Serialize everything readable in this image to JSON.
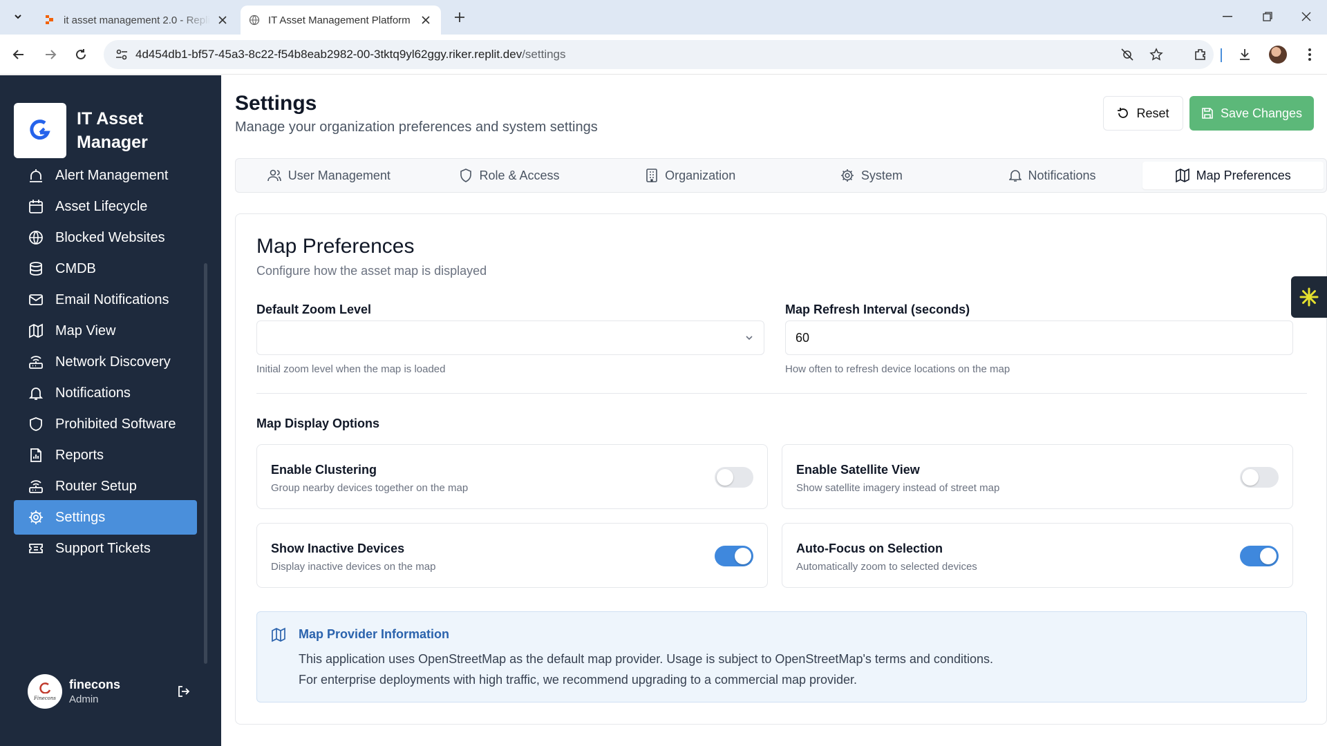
{
  "browser": {
    "tabs": [
      {
        "title": "it asset management 2.0 - Replit",
        "active": false
      },
      {
        "title": "IT Asset Management Platform",
        "active": true
      }
    ],
    "url_host": "4d454db1-bf57-45a3-8c22-f54b8eab2982-00-3tktq9yl62ggy.riker.replit.dev",
    "url_path": "/settings"
  },
  "sidebar": {
    "brand": "IT Asset Manager",
    "items": [
      {
        "label": "Alert Management",
        "icon": "alert-icon"
      },
      {
        "label": "Asset Lifecycle",
        "icon": "calendar-icon"
      },
      {
        "label": "Blocked Websites",
        "icon": "globe-icon"
      },
      {
        "label": "CMDB",
        "icon": "database-icon"
      },
      {
        "label": "Email Notifications",
        "icon": "mail-icon"
      },
      {
        "label": "Map View",
        "icon": "map-icon"
      },
      {
        "label": "Network Discovery",
        "icon": "router-icon"
      },
      {
        "label": "Notifications",
        "icon": "bell-icon"
      },
      {
        "label": "Prohibited Software",
        "icon": "shield-icon"
      },
      {
        "label": "Reports",
        "icon": "report-icon"
      },
      {
        "label": "Router Setup",
        "icon": "router-icon"
      },
      {
        "label": "Settings",
        "icon": "gear-icon",
        "active": true
      },
      {
        "label": "Support Tickets",
        "icon": "ticket-icon"
      }
    ],
    "user": {
      "name": "finecons",
      "role": "Admin",
      "avatar_text": "Finecons"
    }
  },
  "header": {
    "title": "Settings",
    "subtitle": "Manage your organization preferences and system settings",
    "reset_label": "Reset",
    "save_label": "Save Changes"
  },
  "tabs": [
    {
      "label": "User Management",
      "icon": "users-icon"
    },
    {
      "label": "Role & Access",
      "icon": "shield-icon"
    },
    {
      "label": "Organization",
      "icon": "building-icon"
    },
    {
      "label": "System",
      "icon": "gear-icon"
    },
    {
      "label": "Notifications",
      "icon": "bell-icon"
    },
    {
      "label": "Map Preferences",
      "icon": "map-icon",
      "active": true
    }
  ],
  "map_prefs": {
    "title": "Map Preferences",
    "subtitle": "Configure how the asset map is displayed",
    "zoom": {
      "label": "Default Zoom Level",
      "value": "",
      "help": "Initial zoom level when the map is loaded"
    },
    "refresh": {
      "label": "Map Refresh Interval (seconds)",
      "value": "60",
      "help": "How often to refresh device locations on the map"
    },
    "display_title": "Map Display Options",
    "options": [
      {
        "title": "Enable Clustering",
        "desc": "Group nearby devices together on the map",
        "enabled": false
      },
      {
        "title": "Enable Satellite View",
        "desc": "Show satellite imagery instead of street map",
        "enabled": false
      },
      {
        "title": "Show Inactive Devices",
        "desc": "Display inactive devices on the map",
        "enabled": true
      },
      {
        "title": "Auto-Focus on Selection",
        "desc": "Automatically zoom to selected devices",
        "enabled": true
      }
    ],
    "info": {
      "title": "Map Provider Information",
      "line1": "This application uses OpenStreetMap as the default map provider. Usage is subject to OpenStreetMap's terms and conditions.",
      "line2": "For enterprise deployments with high traffic, we recommend upgrading to a commercial map provider."
    }
  },
  "colors": {
    "accent": "#4a8fdb",
    "save": "#5cb879",
    "sidebar_bg": "#1e2a3d",
    "toggle_on": "#3f88dd"
  }
}
